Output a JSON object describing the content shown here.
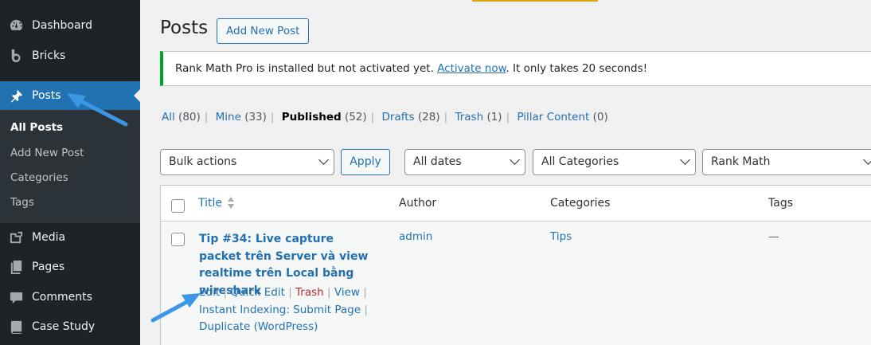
{
  "sidebar": {
    "items": [
      {
        "label": "Dashboard",
        "icon": "dashboard-icon"
      },
      {
        "label": "Bricks",
        "icon": "bricks-icon"
      },
      {
        "label": "Posts",
        "icon": "pin-icon"
      },
      {
        "label": "Media",
        "icon": "media-icon"
      },
      {
        "label": "Pages",
        "icon": "pages-icon"
      },
      {
        "label": "Comments",
        "icon": "comments-icon"
      },
      {
        "label": "Case Study",
        "icon": "book-icon"
      }
    ],
    "submenu": [
      "All Posts",
      "Add New Post",
      "Categories",
      "Tags"
    ]
  },
  "header": {
    "title": "Posts",
    "add_new": "Add New Post"
  },
  "notice": {
    "text_before": "Rank Math Pro is installed but not activated yet. ",
    "link": "Activate now",
    "text_after": ". It only takes 20 seconds!"
  },
  "views": [
    {
      "label": "All",
      "count": "(80)"
    },
    {
      "label": "Mine",
      "count": "(33)"
    },
    {
      "label": "Published",
      "count": "(52)"
    },
    {
      "label": "Drafts",
      "count": "(28)"
    },
    {
      "label": "Trash",
      "count": "(1)"
    },
    {
      "label": "Pillar Content",
      "count": "(0)"
    }
  ],
  "filters": {
    "bulk_actions": "Bulk actions",
    "apply": "Apply",
    "dates": "All dates",
    "categories": "All Categories",
    "rank_math": "Rank Math"
  },
  "table": {
    "columns": [
      "Title",
      "Author",
      "Categories",
      "Tags"
    ],
    "rows": [
      {
        "title": "Tip #34: Live capture packet trên Server và view realtime trên Local bằng wireshark",
        "author": "admin",
        "categories": "Tips",
        "tags": "—",
        "actions": {
          "edit": "Edit",
          "quick_edit": "Quick Edit",
          "trash": "Trash",
          "view": "View",
          "instant_indexing": "Instant Indexing: Submit Page",
          "duplicate": "Duplicate (WordPress)"
        }
      }
    ]
  },
  "colors": {
    "sidebar_bg": "#1d2327",
    "active_bg": "#2271b1",
    "link": "#2271b1",
    "notice_border": "#00a32a",
    "trash": "#b32d2e",
    "arrow": "#3b96e6"
  }
}
